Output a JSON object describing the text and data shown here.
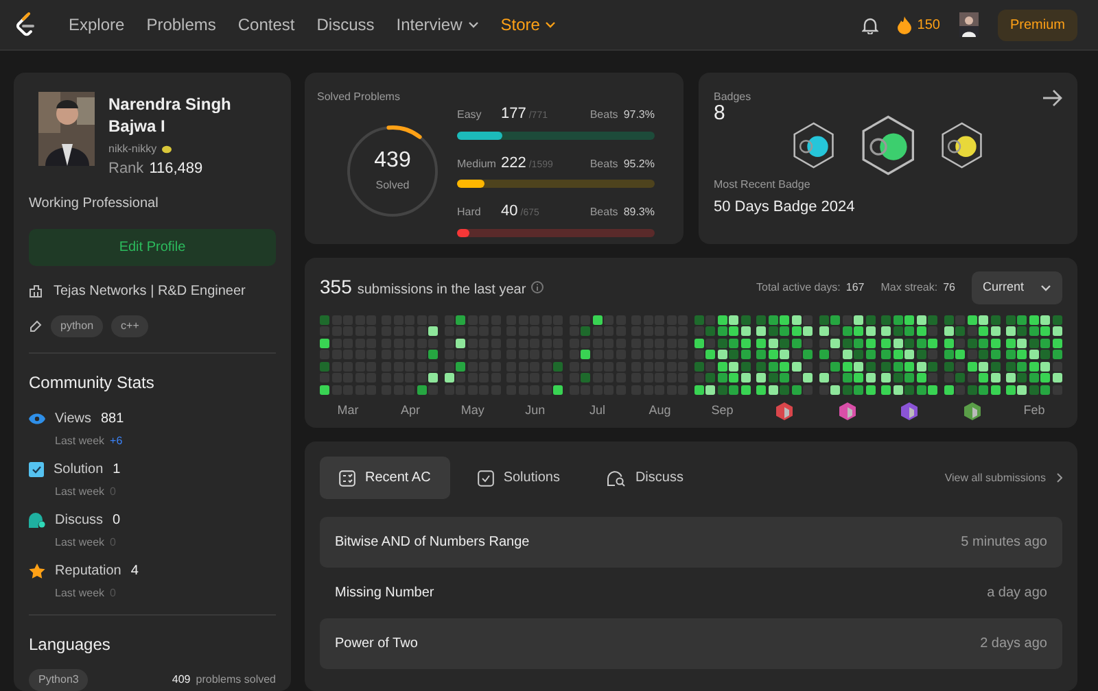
{
  "nav": {
    "links": [
      {
        "label": "Explore",
        "dropdown": false,
        "highlight": false
      },
      {
        "label": "Problems",
        "dropdown": false,
        "highlight": false
      },
      {
        "label": "Contest",
        "dropdown": false,
        "highlight": false
      },
      {
        "label": "Discuss",
        "dropdown": false,
        "highlight": false
      },
      {
        "label": "Interview",
        "dropdown": true,
        "highlight": false
      },
      {
        "label": "Store",
        "dropdown": true,
        "highlight": true
      }
    ],
    "streak": "150",
    "premium": "Premium"
  },
  "profile": {
    "name": "Narendra Singh Bajwa I",
    "username": "nikk-nikky",
    "rank_label": "Rank",
    "rank": "116,489",
    "status": "Working Professional",
    "edit_button": "Edit Profile",
    "company": "Tejas Networks | R&D Engineer",
    "skills": [
      "python",
      "c++"
    ]
  },
  "community": {
    "title": "Community Stats",
    "stats": [
      {
        "kind": "views",
        "label": "Views",
        "value": "881",
        "last_week_label": "Last week",
        "change": "+6",
        "highlight": true
      },
      {
        "kind": "solution",
        "label": "Solution",
        "value": "1",
        "last_week_label": "Last week",
        "change": "0",
        "highlight": false
      },
      {
        "kind": "discuss",
        "label": "Discuss",
        "value": "0",
        "last_week_label": "Last week",
        "change": "0",
        "highlight": false
      },
      {
        "kind": "reputation",
        "label": "Reputation",
        "value": "4",
        "last_week_label": "Last week",
        "change": "0",
        "highlight": false
      }
    ]
  },
  "languages": {
    "title": "Languages",
    "items": [
      {
        "name": "Python3",
        "count": "409",
        "suffix": "problems solved"
      }
    ]
  },
  "solved": {
    "title": "Solved Problems",
    "total": "439",
    "total_label": "Solved",
    "level": 0.12,
    "levels": [
      {
        "kind": "easy",
        "label": "Easy",
        "solved": "177",
        "total": "/771",
        "beats_label": "Beats",
        "beats": "97.3%",
        "level": 0.23
      },
      {
        "kind": "medium",
        "label": "Medium",
        "solved": "222",
        "total": "/1599",
        "beats_label": "Beats",
        "beats": "95.2%",
        "level": 0.14
      },
      {
        "kind": "hard",
        "label": "Hard",
        "solved": "40",
        "total": "/675",
        "beats_label": "Beats",
        "beats": "89.3%",
        "level": 0.06
      }
    ]
  },
  "badges": {
    "title": "Badges",
    "count": "8",
    "items": [
      {
        "color": "#26c6da",
        "selected": false
      },
      {
        "color": "#3ccf6e",
        "selected": true
      },
      {
        "color": "#e8d83a",
        "selected": false
      }
    ],
    "recent_label": "Most Recent Badge",
    "recent": "50 Days Badge 2024"
  },
  "activity": {
    "count": "355",
    "text": "submissions in the last year",
    "active_label": "Total active days:",
    "active": "167",
    "streak_label": "Max streak:",
    "streak": "76",
    "dropdown": "Current",
    "months": [
      {
        "kind": "label",
        "label": "Mar",
        "active": false
      },
      {
        "kind": "label",
        "label": "Apr",
        "active": false
      },
      {
        "kind": "label",
        "label": "May",
        "active": false
      },
      {
        "kind": "label",
        "label": "Jun",
        "active": false
      },
      {
        "kind": "label",
        "label": "Jul",
        "active": false
      },
      {
        "kind": "label",
        "label": "Aug",
        "active": false
      },
      {
        "kind": "label",
        "label": "Sep",
        "active": true
      },
      {
        "kind": "badge",
        "color": "#d9464b",
        "active": true
      },
      {
        "kind": "badge",
        "color": "#d94fa8",
        "active": true
      },
      {
        "kind": "badge",
        "color": "#8b54d6",
        "active": true
      },
      {
        "kind": "badge",
        "color": "#5a9e48",
        "active": true
      },
      {
        "kind": "label",
        "label": "Feb",
        "active": true
      }
    ]
  },
  "recent": {
    "tabs": [
      {
        "kind": "ac",
        "label": "Recent AC",
        "selected": true
      },
      {
        "kind": "solutions",
        "label": "Solutions",
        "selected": false
      },
      {
        "kind": "discuss",
        "label": "Discuss",
        "selected": false
      }
    ],
    "view_all": "View all submissions",
    "rows": [
      {
        "title": "Bitwise AND of Numbers Range",
        "time": "5 minutes ago"
      },
      {
        "title": "Missing Number",
        "time": "a day ago"
      },
      {
        "title": "Power of Two",
        "time": "2 days ago"
      }
    ]
  }
}
